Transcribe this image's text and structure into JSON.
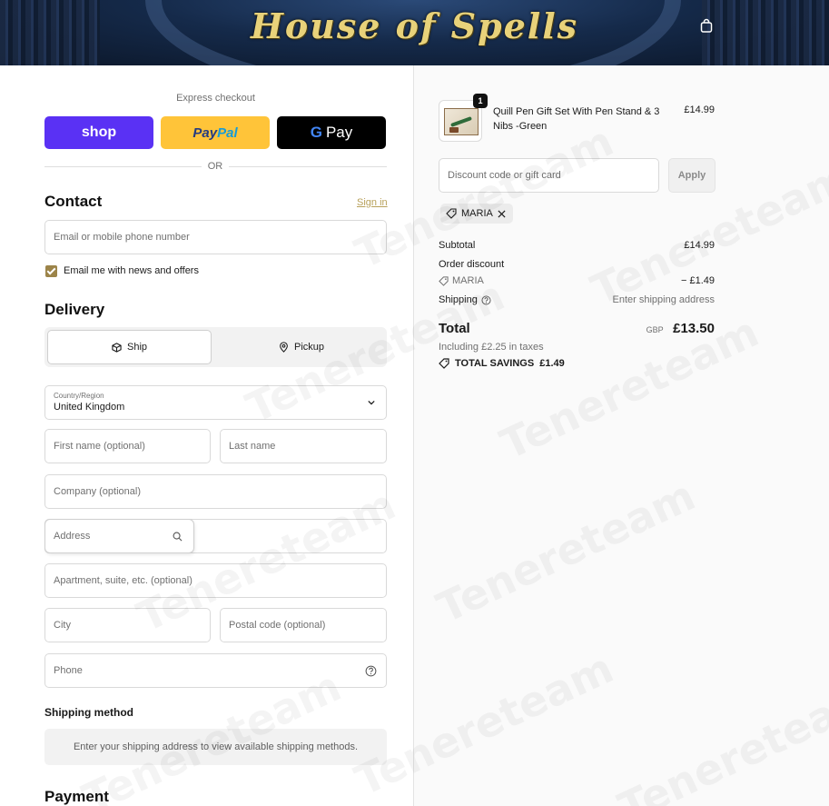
{
  "header": {
    "logo_text": "House of Spells",
    "bag_icon": "shopping-bag-icon"
  },
  "express": {
    "label": "Express checkout",
    "shop_label": "shop",
    "paypal_part1": "Pay",
    "paypal_part2": "Pal",
    "gpay_g": "G",
    "gpay_label": "Pay",
    "or_text": "OR"
  },
  "contact": {
    "title": "Contact",
    "sign_in": "Sign in",
    "email_placeholder": "Email or mobile phone number",
    "newsletter_label": "Email me with news and offers",
    "newsletter_checked": true
  },
  "delivery": {
    "title": "Delivery",
    "ship_label": "Ship",
    "pickup_label": "Pickup",
    "country_label": "Country/Region",
    "country_value": "United Kingdom",
    "first_name_placeholder": "First name (optional)",
    "last_name_placeholder": "Last name",
    "company_placeholder": "Company (optional)",
    "address_placeholder": "Address",
    "apartment_placeholder": "Apartment, suite, etc. (optional)",
    "city_placeholder": "City",
    "postal_placeholder": "Postal code (optional)",
    "phone_placeholder": "Phone"
  },
  "shipping_method": {
    "title": "Shipping method",
    "empty_message": "Enter your shipping address to view available shipping methods."
  },
  "payment": {
    "title": "Payment"
  },
  "order": {
    "item": {
      "quantity": "1",
      "name": "Quill Pen Gift Set With Pen Stand & 3 Nibs -Green",
      "price": "£14.99"
    },
    "discount_placeholder": "Discount code or gift card",
    "apply_label": "Apply",
    "applied_code": "MARIA",
    "subtotal_label": "Subtotal",
    "subtotal_value": "£14.99",
    "order_discount_label": "Order discount",
    "discount_code": "MARIA",
    "discount_value": "− £1.49",
    "shipping_label": "Shipping",
    "shipping_value": "Enter shipping address",
    "total_label": "Total",
    "total_currency": "GBP",
    "total_value": "£13.50",
    "tax_line": "Including £2.25 in taxes",
    "savings_label": "TOTAL SAVINGS",
    "savings_value": "£1.49"
  },
  "watermark_text": "Tenereteam"
}
